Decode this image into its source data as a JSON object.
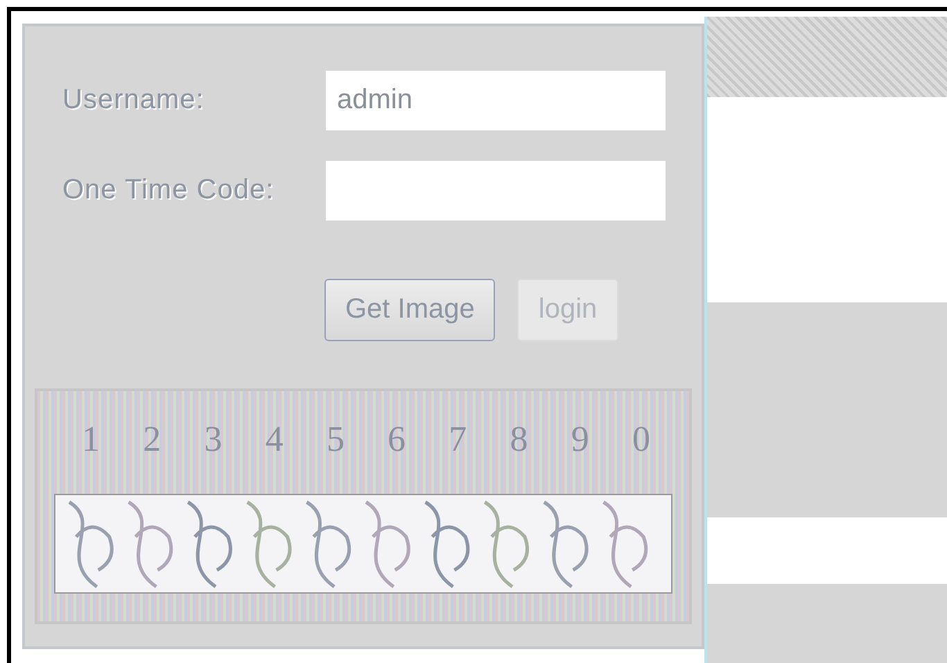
{
  "login_form": {
    "fields": [
      {
        "label": "Username:",
        "value": "admin"
      },
      {
        "label": "One Time Code:"
      }
    ],
    "buttons": [
      {
        "label": "Get Image",
        "disabled": false
      },
      {
        "label": "login",
        "disabled": true
      }
    ]
  },
  "code_image": {
    "digits": [
      "1",
      "2",
      "3",
      "4",
      "5",
      "6",
      "7",
      "8",
      "9",
      "0"
    ]
  }
}
